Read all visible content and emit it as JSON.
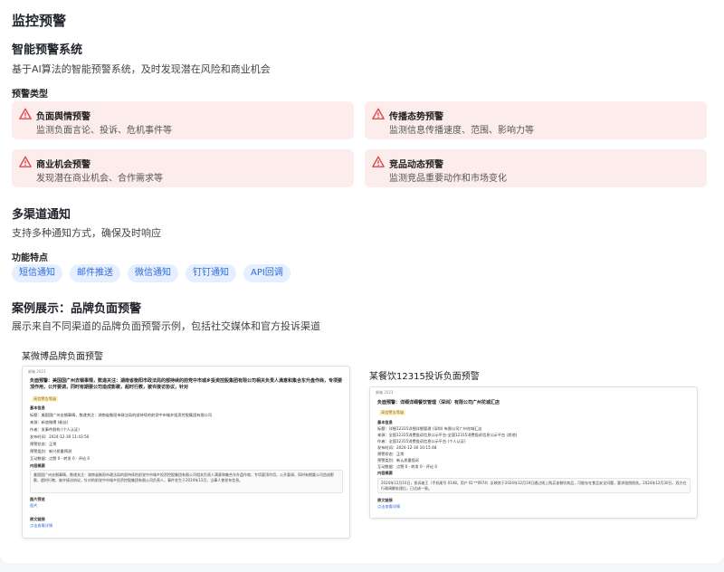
{
  "page": {
    "title": "监控预警",
    "system_title": "智能预警系统",
    "system_desc": "基于AI算法的智能预警系统，及时发现潜在风险和商业机会",
    "types_label": "预警类型",
    "alert_types": [
      {
        "title": "负面舆情预警",
        "desc": "监测负面言论、投诉、危机事件等"
      },
      {
        "title": "传播态势预警",
        "desc": "监测信息传播速度、范围、影响力等"
      },
      {
        "title": "商业机会预警",
        "desc": "发现潜在商业机会、合作需求等"
      },
      {
        "title": "竞品动态预警",
        "desc": "监测竞品重要动作和市场变化"
      }
    ],
    "channel_title": "多渠道通知",
    "channel_desc": "支持多种通知方式，确保及时响应",
    "features_label": "功能特点",
    "features": [
      "短信通知",
      "邮件推送",
      "微信通知",
      "钉钉通知",
      "API回调"
    ],
    "case_title": "案例展示：品牌负面预警",
    "case_desc": "展示来自不同渠道的品牌负面预警示例，包括社交媒体和官方投诉渠道"
  },
  "examples": [
    {
      "caption": "某微博品牌负面预警",
      "window_label": "邮箱 2023",
      "headline": "负面预警：美国国广州去钢事情，数递关注：湖南省衡阳市政法局的部持续的前党中市城乡投资控股集团有限公司相关负责人满意和集合东升盘作商，专项要顶作用，公开要调，同时有期要公司造成影歌，超时行教，被许接访协议，针对",
      "badge": "高信警告等级",
      "lines": [
        "基本信息",
        "标题：美国国广州去钢事情，数递关注：湖南省衡阳市政法局的部持续的前党中市城乡投资控股集团有限公司",
        "来源：新浪微博 (粉丝)",
        "作者：发事件群构 (个人认证)",
        "发布时间：2024-12-30 11:43:50",
        "预警状态：正常",
        "预警类别：新兴质量预测",
        "互动数据：点赞 0 · 转发 0 · 评论 0",
        "内容摘要"
      ],
      "body": "美国国广州去钢事情，数递关注：湖南省衡阳市政法局的部持续的前党中市城乡投资控股集团有限公司相关负责人满意和集合东升盘作商，专项要顶作用，公开要调，同时有期要公司造成影歌，超时行教，被许接访协议，针对的前党中市城乡投资控股集团有限公司负责人，事件发生于2024年12月，当事人曾发布信息。",
      "image_label": "图片预览",
      "image_link": "图片",
      "source_label": "原文链接",
      "source_link": "点击查看详情"
    },
    {
      "caption": "某餐饮12315投诉负面预警",
      "window_label": "邮箱 2023",
      "headline": "负面预警：详细详细餐饮管理（深圳）有限公司广州花城汇店",
      "badge": "高信警告等级",
      "lines": [
        "基本信息",
        "标题：详细12315详细详细管理 (深圳) 有限公司广州花城汇店",
        "来源：全国12315消费投诉信息公示平台-全国12315消费投诉信息公示平台 (其他)",
        "作者：全国12315消费投诉信息公示平台 (个人认证)",
        "发布时间：2024-12-30 10:15:48",
        "预警状态：正常",
        "预警类别：新认质量投诉",
        "互动数据：点赞 0 · 转发 0 · 评论 0",
        "内容摘要"
      ],
      "body": "2024年12月10日，投诉者王（手机尾号 0148，用户 ID **0974）反映其于2024年12月19日通过线上购买该餐饮商品，可能存在食品安全问题，要求赔偿损失。2024年12月30日，双方在行政调解处理后，已达成一致。",
      "source_label": "原文链接",
      "source_link": "点击查看详情"
    }
  ],
  "colors": {
    "alert_bg": "#fdecec",
    "alert_icon": "#e03e3e",
    "tag_bg": "#e6efff",
    "tag_text": "#2f6bd9"
  }
}
